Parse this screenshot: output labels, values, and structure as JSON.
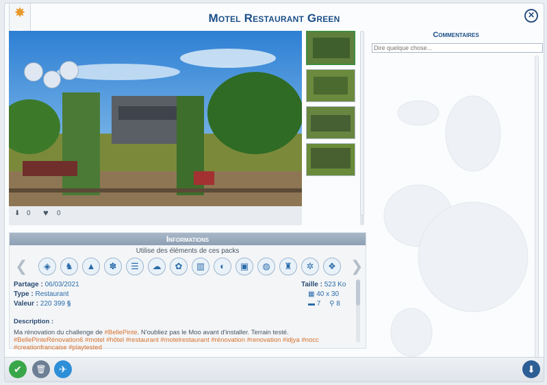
{
  "header": {
    "title": "Motel Restaurant Green",
    "close_glyph": "✕"
  },
  "ribbon": {
    "icon": "gallery-star-icon",
    "glyph": "✸"
  },
  "image_stats": {
    "downloads": "0",
    "likes": "0"
  },
  "info": {
    "header": "Informations",
    "packs_caption": "Utilise des éléments de ces packs",
    "pack_icons": [
      "◈",
      "♞",
      "▲",
      "✽",
      "☰",
      "☁",
      "✿",
      "▥",
      "◐",
      "▣",
      "◍",
      "♜",
      "✲",
      "❖"
    ],
    "share_label": "Partage :",
    "share_value": "06/03/2021",
    "type_label": "Type :",
    "type_value": "Restaurant",
    "value_label": "Valeur :",
    "value_value": "220 399",
    "value_currency": "§",
    "size_label": "Taille :",
    "size_value": "523 Ko",
    "lot_size": "40 x 30",
    "beds": "7",
    "baths": "8",
    "desc_label": "Description :",
    "desc_text": "Ma rénovation du challenge de ",
    "desc_tag1": "#BellePinte",
    "desc_text2": ". N'oubliez pas le Moo avant d'installer. Terrain testé.",
    "desc_tags": "#BellePinteRénovation6 #motel #hôtel #restaurant #motelrestaurant #rénovation #renovation #idjya #nocc #creationfrancaise #playtested"
  },
  "comments": {
    "header": "Commentaires",
    "placeholder": "Dire quelque chose..."
  },
  "bottom": {
    "ok_glyph": "✔",
    "delete_glyph": "🗑",
    "twitter_glyph": "✈",
    "download_glyph": "⬇"
  },
  "colors": {
    "accent": "#1b4f88",
    "link": "#2a6ba8",
    "tag": "#d6702b",
    "ok": "#3aa64a",
    "twitter": "#2d8fd8"
  }
}
